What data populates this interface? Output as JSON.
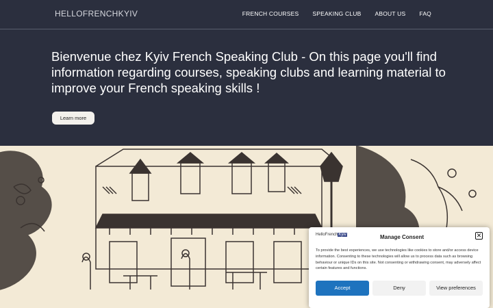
{
  "header": {
    "brand": "HELLOFRENCHKYIV",
    "nav": [
      "FRENCH COURSES",
      "SPEAKING CLUB",
      "ABOUT US",
      "FAQ"
    ]
  },
  "hero": {
    "text": "Bienvenue chez Kyiv French Speaking Club - On this page you'll find information regarding courses, speaking clubs and learning material to improve your French speaking skills !",
    "button": "Learn more"
  },
  "consent": {
    "logo_left": "HelloFrench",
    "logo_right": "Kyiv",
    "title": "Manage Consent",
    "close": "✕",
    "body": "To provide the best experiences, we use technologies like cookies to store and/or access device information. Consenting to these technologies will allow us to process data such as browsing behaviour or unique IDs on this site. Not consenting or withdrawing consent, may adversely affect certain features and functions.",
    "accept": "Accept",
    "deny": "Deny",
    "preferences": "View preferences"
  },
  "colors": {
    "header_bg": "#2b2f3e",
    "sketch_bg": "#f3ead6",
    "ink": "#3a3330",
    "accept": "#1e73be"
  }
}
